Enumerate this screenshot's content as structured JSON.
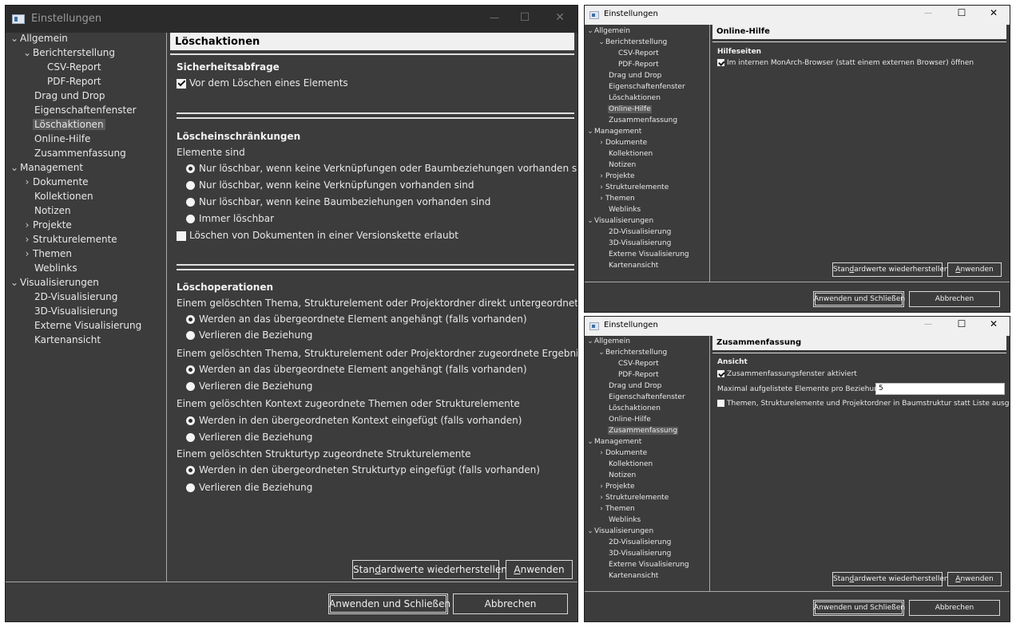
{
  "window_title": "Einstellungen",
  "window_controls": {
    "minimize": "—",
    "maximize": "☐",
    "close": "✕"
  },
  "tree": {
    "allgemein": "Allgemein",
    "berichterstellung": "Berichterstellung",
    "csv_report": "CSV-Report",
    "pdf_report": "PDF-Report",
    "drag_drop": "Drag und Drop",
    "eigenschaftenfenster": "Eigenschaftenfenster",
    "loeschaktionen": "Löschaktionen",
    "online_hilfe": "Online-Hilfe",
    "zusammenfassung": "Zusammenfassung",
    "management": "Management",
    "dokumente": "Dokumente",
    "kollektionen": "Kollektionen",
    "notizen": "Notizen",
    "projekte": "Projekte",
    "strukturelemente": "Strukturelemente",
    "themen": "Themen",
    "weblinks": "Weblinks",
    "visualisierungen": "Visualisierungen",
    "vis_2d": "2D-Visualisierung",
    "vis_3d": "3D-Visualisierung",
    "vis_extern": "Externe Visualisierung",
    "kartenansicht": "Kartenansicht"
  },
  "icons": {
    "expanded": "chevron-down-icon",
    "collapsed": "chevron-right-icon"
  },
  "buttons": {
    "restore_pre": "Stan",
    "restore_key": "d",
    "restore_post": "ardwerte wiederherstellen",
    "apply_key": "A",
    "apply_post": "nwenden",
    "apply_close": "Anwenden und Schließen",
    "cancel": "Abbrechen"
  },
  "main": {
    "header": "Löschaktionen",
    "sicherheit": {
      "title": "Sicherheitsabfrage",
      "checkbox": "Vor dem Löschen eines Elements",
      "checked": true
    },
    "einschraenkungen": {
      "title": "Löscheinschränkungen",
      "label": "Elemente sind",
      "options": [
        "Nur löschbar, wenn keine Verknüpfungen oder Baumbeziehungen vorhanden sind",
        "Nur löschbar, wenn keine Verknüpfungen vorhanden sind",
        "Nur löschbar, wenn keine Baumbeziehungen vorhanden sind",
        "Immer löschbar"
      ],
      "selected_index": 0,
      "versionskette": "Löschen von Dokumenten in einer Versionskette erlaubt",
      "versionskette_checked": false
    },
    "operationen": {
      "title": "Löschoperationen",
      "groups": [
        {
          "label": "Einem gelöschten Thema, Strukturelement oder Projektordner direkt untergeordnete Elemente",
          "opt1": "Werden an das übergeordnete Element angehängt (falls vorhanden)",
          "opt2": "Verlieren die Beziehung"
        },
        {
          "label": "Einem gelöschten Thema, Strukturelement oder Projektordner zugeordnete Ergebnisse",
          "opt1": "Werden an das übergeordnete Element angehängt (falls vorhanden)",
          "opt2": "Verlieren die Beziehung"
        },
        {
          "label": "Einem gelöschten Kontext zugeordnete Themen oder Strukturelemente",
          "opt1": "Werden in den übergeordneten Kontext eingefügt (falls vorhanden)",
          "opt2": "Verlieren die Beziehung"
        },
        {
          "label": "Einem gelöschten Strukturtyp zugeordnete Strukturelemente",
          "opt1": "Werden in den übergeordneten Strukturtyp eingefügt (falls vorhanden)",
          "opt2": "Verlieren die Beziehung"
        }
      ],
      "selected_index": 0
    }
  },
  "online": {
    "header": "Online-Hilfe",
    "section": "Hilfeseiten",
    "checkbox": "Im internen MonArch-Browser (statt einem externen Browser) öffnen",
    "checked": true
  },
  "summary": {
    "header": "Zusammenfassung",
    "section": "Ansicht",
    "checkbox1": "Zusammenfassungsfenster aktiviert",
    "checkbox1_checked": true,
    "max_label": "Maximal aufgelistete Elemente pro Beziehung",
    "max_value": "5",
    "checkbox2": "Themen, Strukturelemente und Projektordner in Baumstruktur statt Liste ausgeben",
    "checkbox2_checked": false
  }
}
